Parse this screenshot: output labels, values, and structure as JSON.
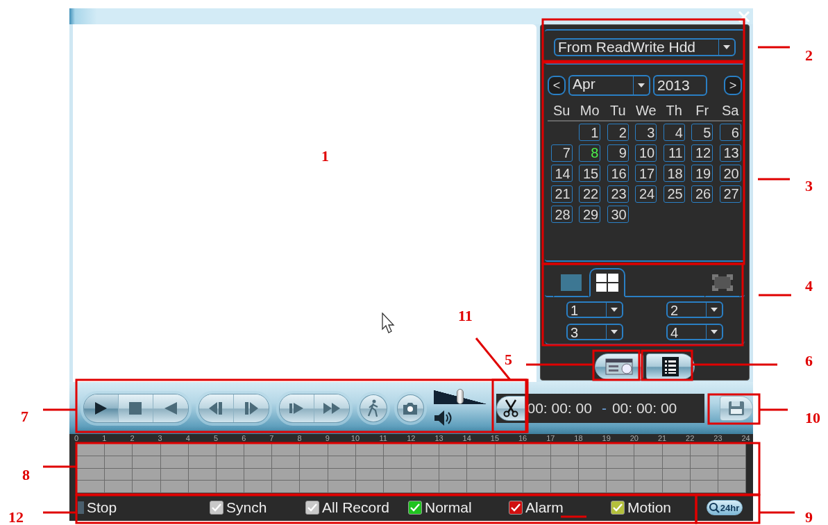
{
  "callouts": [
    {
      "label": "2"
    },
    {
      "label": "1"
    },
    {
      "label": "3"
    },
    {
      "label": "4"
    },
    {
      "label": "11"
    },
    {
      "label": "5"
    },
    {
      "label": "6"
    },
    {
      "label": "7"
    },
    {
      "label": "10"
    },
    {
      "label": "8"
    },
    {
      "label": "12"
    },
    {
      "label": "9"
    }
  ],
  "source": {
    "value": "From ReadWrite Hdd"
  },
  "calendar": {
    "prev": "<",
    "next": ">",
    "month": "Apr",
    "year": "2013",
    "weekdays": [
      "Su",
      "Mo",
      "Tu",
      "We",
      "Th",
      "Fr",
      "Sa"
    ],
    "weeks": [
      {
        "days": [
          {
            "label": "1",
            "selected": false
          },
          {
            "label": "2",
            "selected": false
          },
          {
            "label": "3",
            "selected": false
          },
          {
            "label": "4",
            "selected": false
          },
          {
            "label": "5",
            "selected": false
          },
          {
            "label": "6",
            "selected": false
          }
        ]
      },
      {
        "days": [
          {
            "label": "7",
            "selected": false
          },
          {
            "label": "8",
            "selected": true
          },
          {
            "label": "9",
            "selected": false
          },
          {
            "label": "10",
            "selected": false
          },
          {
            "label": "11",
            "selected": false
          },
          {
            "label": "12",
            "selected": false
          },
          {
            "label": "13",
            "selected": false
          }
        ]
      },
      {
        "days": [
          {
            "label": "14",
            "selected": false
          },
          {
            "label": "15",
            "selected": false
          },
          {
            "label": "16",
            "selected": false
          },
          {
            "label": "17",
            "selected": false
          },
          {
            "label": "18",
            "selected": false
          },
          {
            "label": "19",
            "selected": false
          },
          {
            "label": "20",
            "selected": false
          }
        ]
      },
      {
        "days": [
          {
            "label": "21",
            "selected": false
          },
          {
            "label": "22",
            "selected": false
          },
          {
            "label": "23",
            "selected": false
          },
          {
            "label": "24",
            "selected": false
          },
          {
            "label": "25",
            "selected": false
          },
          {
            "label": "26",
            "selected": false
          },
          {
            "label": "27",
            "selected": false
          }
        ]
      },
      {
        "days": [
          {
            "label": "28",
            "selected": false
          },
          {
            "label": "29",
            "selected": false
          },
          {
            "label": "30",
            "selected": false
          }
        ]
      }
    ]
  },
  "layouts": [
    {
      "kind": "single",
      "selected": false
    },
    {
      "kind": "quad",
      "selected": true
    },
    {
      "kind": "fullscreen",
      "selected": false
    }
  ],
  "channels": [
    {
      "value": "1"
    },
    {
      "value": "2"
    },
    {
      "value": "3"
    },
    {
      "value": "4"
    }
  ],
  "volume": {
    "level": 0.5
  },
  "clip": {
    "start": "00: 00: 00",
    "separator": "-",
    "end": "00: 00: 00"
  },
  "timeline": {
    "hours": [
      "0",
      "1",
      "2",
      "3",
      "4",
      "5",
      "6",
      "7",
      "8",
      "9",
      "10",
      "11",
      "12",
      "13",
      "14",
      "15",
      "16",
      "17",
      "18",
      "19",
      "20",
      "21",
      "22",
      "23",
      "24"
    ]
  },
  "status": [
    {
      "kind": "indicator",
      "label": "Stop"
    },
    {
      "kind": "checkbox",
      "label": "Synch",
      "checked": true,
      "color": "#c8c8c8"
    },
    {
      "kind": "checkbox",
      "label": "All Record",
      "checked": true,
      "color": "#c8c8c8"
    },
    {
      "kind": "checkbox",
      "label": "Normal",
      "checked": true,
      "color": "#1fc41f"
    },
    {
      "kind": "checkbox",
      "label": "Alarm",
      "checked": true,
      "color": "#d01010"
    },
    {
      "kind": "checkbox",
      "label": "Motion",
      "checked": true,
      "color": "#b4c03c"
    }
  ],
  "range_button": {
    "label": "24hr"
  }
}
